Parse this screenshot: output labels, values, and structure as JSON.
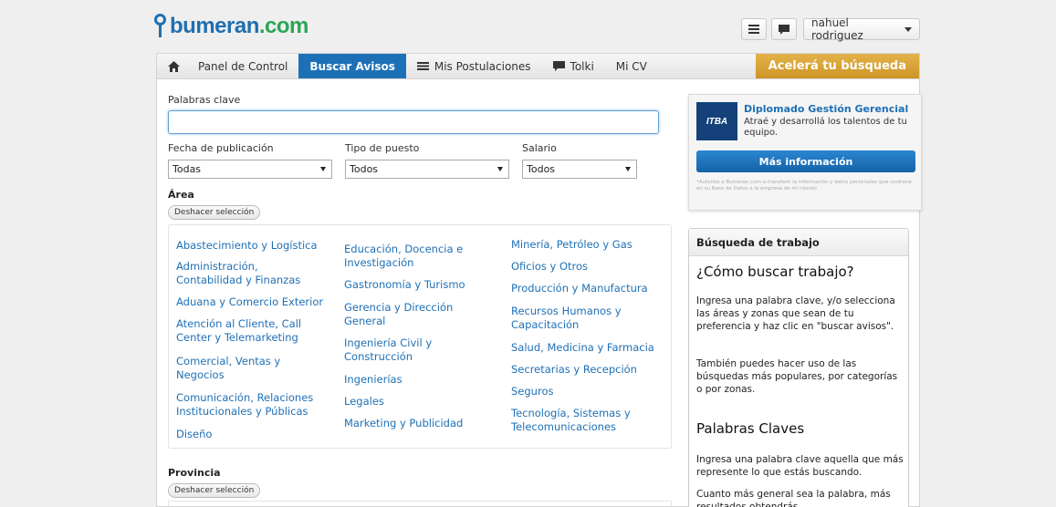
{
  "header": {
    "logo_text": "bumeran",
    "logo_suffix": ".com",
    "user_name": "nahuel rodriguez",
    "icons": [
      "menu-icon",
      "chat-icon"
    ]
  },
  "nav": {
    "items": [
      {
        "label": "",
        "icon": "home-icon"
      },
      {
        "label": "Panel de Control"
      },
      {
        "label": "Buscar Avisos",
        "active": true
      },
      {
        "label": "Mis Postulaciones",
        "icon": "list-icon"
      },
      {
        "label": "Tolki",
        "icon": "chat-icon"
      },
      {
        "label": "Mi CV"
      }
    ],
    "cta": "Acelerá tu búsqueda"
  },
  "search": {
    "keywords_label": "Palabras clave",
    "keywords_value": "",
    "date_label": "Fecha de publicación",
    "date_value": "Todas",
    "type_label": "Tipo de puesto",
    "type_value": "Todos",
    "salary_label": "Salario",
    "salary_value": "Todos"
  },
  "area": {
    "title": "Área",
    "clear_label": "Deshacer selección",
    "col1": [
      "Abastecimiento y Logística",
      "Administración, Contabilidad y Finanzas",
      "Aduana y Comercio Exterior",
      "Atención al Cliente, Call Center y Telemarketing",
      "Comercial, Ventas y Negocios",
      "Comunicación, Relaciones Institucionales y Públicas",
      "Diseño"
    ],
    "col2": [
      "Educación, Docencia e Investigación",
      "Gastronomía y Turismo",
      "Gerencia y Dirección General",
      "Ingeniería Civil y Construcción",
      "Ingenierías",
      "Legales",
      "Marketing y Publicidad"
    ],
    "col3": [
      "Minería, Petróleo y Gas",
      "Oficios y Otros",
      "Producción y Manufactura",
      "Recursos Humanos y Capacitación",
      "Salud, Medicina y Farmacia",
      "Secretarias y Recepción",
      "Seguros",
      "Tecnología, Sistemas y Telecomunicaciones"
    ]
  },
  "province": {
    "title": "Provincia",
    "clear_label": "Deshacer selección"
  },
  "ad": {
    "logo_text": "ITBA",
    "title": "Diplomado Gestión Gerencial",
    "description": "Atraé y desarrollá los talentos de tu equipo.",
    "button": "Más información",
    "legal": "*Autorizo a Bumeran.com a transferir la información y datos personales que contiene en su Base de Datos a la empresa de mi interés"
  },
  "help": {
    "header": "Búsqueda de trabajo",
    "h1": "¿Cómo buscar trabajo?",
    "p1": "Ingresa una palabra clave, y/o selecciona las áreas y zonas que sean de tu preferencia y haz clic en \"buscar avisos\".",
    "p2": "También puedes hacer uso de las búsquedas más populares, por categorías o por zonas.",
    "h2": "Palabras Claves",
    "p3": "Ingresa una palabra clave aquella que más represente lo que estás buscando.",
    "p4": "Cuanto más general sea la palabra, más resultados obtendrás."
  },
  "colors": {
    "brand_blue": "#1f6fb0",
    "brand_green": "#2aa655",
    "cta_gold": "#d9a33b",
    "link": "#1e70b6"
  }
}
